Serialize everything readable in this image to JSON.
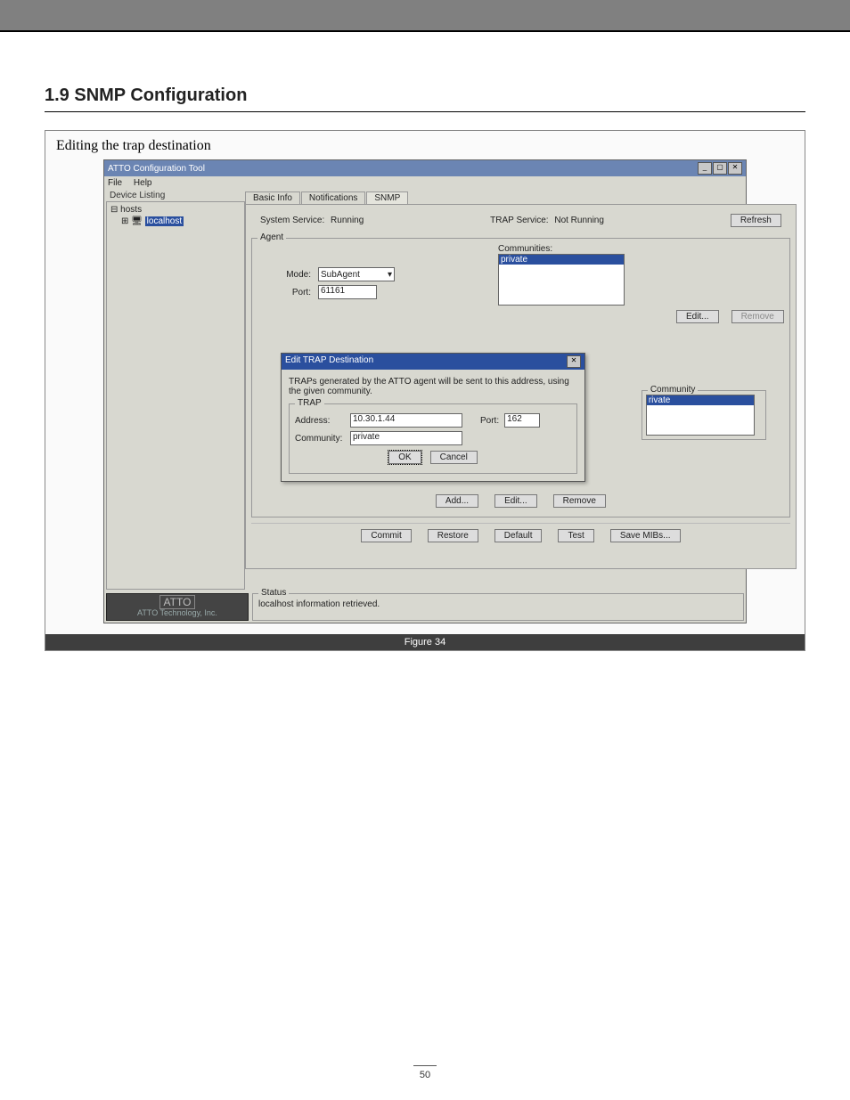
{
  "section_title": "1.9 SNMP Configuration",
  "figure_heading": "Editing the trap destination",
  "caption": "Figure 34",
  "page_number": "50",
  "window": {
    "title": "ATTO Configuration Tool",
    "menus": [
      "File",
      "Help"
    ],
    "win_btns": {
      "min": "_",
      "max": "▢",
      "close": "✕"
    }
  },
  "tree": {
    "panel_title": "Device Listing",
    "root_toggle": "⊟",
    "root": "hosts",
    "child_toggle": "⊞",
    "child_icon": "🖥",
    "child": "localhost"
  },
  "tabs": {
    "t1": "Basic Info",
    "t2": "Notifications",
    "t3": "SNMP"
  },
  "top": {
    "sys_label": "System Service:",
    "sys_value": "Running",
    "trap_label": "TRAP Service:",
    "trap_value": "Not Running",
    "refresh": "Refresh"
  },
  "agent": {
    "legend": "Agent",
    "mode_label": "Mode:",
    "mode_value": "SubAgent",
    "port_label": "Port:",
    "port_value": "61161",
    "communities_label": "Communities:",
    "communities_selected": "private",
    "edit_btn": "Edit...",
    "remove_btn": "Remove"
  },
  "dialog": {
    "title": "Edit TRAP Destination",
    "close": "✕",
    "msg": "TRAPs generated by the ATTO agent will be sent to this address, using the given community.",
    "frame_legend": "TRAP",
    "addr_label": "Address:",
    "addr_value": "10.30.1.44",
    "port_label": "Port:",
    "port_value": "162",
    "comm_label": "Community:",
    "comm_value": "private",
    "ok": "OK",
    "cancel": "Cancel"
  },
  "community_panel": {
    "legend": "Community",
    "item": "rivate"
  },
  "trap_buttons": {
    "add": "Add...",
    "edit": "Edit...",
    "remove": "Remove"
  },
  "bottom_buttons": {
    "commit": "Commit",
    "restore": "Restore",
    "default": "Default",
    "test": "Test",
    "save": "Save MIBs..."
  },
  "status": {
    "legend": "Status",
    "msg": "localhost information retrieved."
  },
  "logo": {
    "l1": "ATTO",
    "l2": "ATTO Technology, Inc."
  }
}
